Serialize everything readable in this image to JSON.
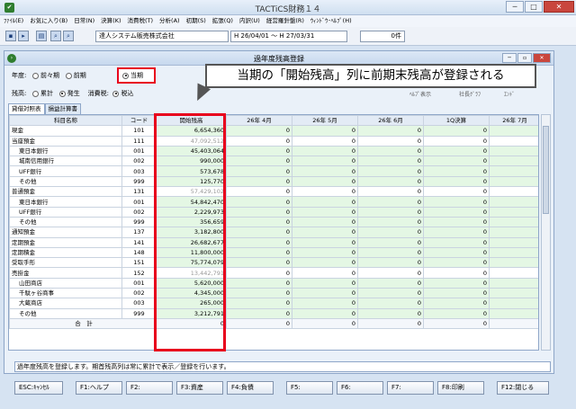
{
  "window_title": "TACTiCS財務１４",
  "menu": [
    "ﾌｧｲﾙ(E)",
    "お気に入り(B)",
    "日常(N)",
    "決算(K)",
    "消費税(T)",
    "分析(A)",
    "初期(S)",
    "拡張(Q)",
    "内訳(U)",
    "経営羅針盤(R)",
    "ｳｨﾝﾄﾞｳ･ﾍﾙﾌﾟ(H)"
  ],
  "toolbar": {
    "company": "達人システム販売株式会社",
    "period": "H 26/04/01 ～ H 27/03/31",
    "count": "0件"
  },
  "dialog_title": "過年度残高登録",
  "options": {
    "year_label": "年度:",
    "year_options": [
      "前々期",
      "前期",
      "当期"
    ],
    "year_selected": "当期",
    "balance_label": "残高:",
    "balance_options": [
      "累計",
      "発生"
    ],
    "balance_selected": "発生",
    "tax_label": "消費税:",
    "tax_value": "税込"
  },
  "callout": "当期の「開始残高」列に前期末残高が登録される",
  "right_links": [
    "ﾍﾙﾌﾟ表示",
    "社長ｸﾞﾗﾌ",
    "ｴﾝﾄﾞ"
  ],
  "tabs": [
    "貸借対照表",
    "損益計算書"
  ],
  "table": {
    "headers": [
      "科目名称",
      "コード",
      "開始残高",
      "26年 4月",
      "26年 5月",
      "26年 6月",
      "1Q決算",
      "26年 7月"
    ],
    "rows": [
      {
        "name": "現金",
        "code": "101",
        "start": "6,654,360",
        "vals": [
          "0",
          "0",
          "0",
          "0"
        ],
        "indent": 0,
        "green": true,
        "gray": false
      },
      {
        "name": "当座預金",
        "code": "111",
        "start": "47,092,512",
        "vals": [
          "0",
          "0",
          "0",
          "0"
        ],
        "indent": 0,
        "green": false,
        "gray": true
      },
      {
        "name": "東日本銀行",
        "code": "001",
        "start": "45,403,064",
        "vals": [
          "0",
          "0",
          "0",
          "0"
        ],
        "indent": 1,
        "green": true,
        "gray": false
      },
      {
        "name": "城南信用銀行",
        "code": "002",
        "start": "990,000",
        "vals": [
          "0",
          "0",
          "0",
          "0"
        ],
        "indent": 1,
        "green": true,
        "gray": false
      },
      {
        "name": "UFF銀行",
        "code": "003",
        "start": "573,678",
        "vals": [
          "0",
          "0",
          "0",
          "0"
        ],
        "indent": 1,
        "green": true,
        "gray": false
      },
      {
        "name": "その他",
        "code": "999",
        "start": "125,770",
        "vals": [
          "0",
          "0",
          "0",
          "0"
        ],
        "indent": 1,
        "green": true,
        "gray": false
      },
      {
        "name": "普通預金",
        "code": "131",
        "start": "57,429,102",
        "vals": [
          "0",
          "0",
          "0",
          "0"
        ],
        "indent": 0,
        "green": false,
        "gray": true
      },
      {
        "name": "東日本銀行",
        "code": "001",
        "start": "54,842,470",
        "vals": [
          "0",
          "0",
          "0",
          "0"
        ],
        "indent": 1,
        "green": true,
        "gray": false
      },
      {
        "name": "UFF銀行",
        "code": "002",
        "start": "2,229,973",
        "vals": [
          "0",
          "0",
          "0",
          "0"
        ],
        "indent": 1,
        "green": true,
        "gray": false
      },
      {
        "name": "その他",
        "code": "999",
        "start": "356,659",
        "vals": [
          "0",
          "0",
          "0",
          "0"
        ],
        "indent": 1,
        "green": true,
        "gray": false
      },
      {
        "name": "通知預金",
        "code": "137",
        "start": "3,182,800",
        "vals": [
          "0",
          "0",
          "0",
          "0"
        ],
        "indent": 0,
        "green": true,
        "gray": false
      },
      {
        "name": "定期預金",
        "code": "141",
        "start": "26,682,677",
        "vals": [
          "0",
          "0",
          "0",
          "0"
        ],
        "indent": 0,
        "green": true,
        "gray": false
      },
      {
        "name": "定期積金",
        "code": "148",
        "start": "11,800,000",
        "vals": [
          "0",
          "0",
          "0",
          "0"
        ],
        "indent": 0,
        "green": true,
        "gray": false
      },
      {
        "name": "受取手形",
        "code": "151",
        "start": "75,774,079",
        "vals": [
          "0",
          "0",
          "0",
          "0"
        ],
        "indent": 0,
        "green": true,
        "gray": false
      },
      {
        "name": "売掛金",
        "code": "152",
        "start": "13,442,791",
        "vals": [
          "0",
          "0",
          "0",
          "0"
        ],
        "indent": 0,
        "green": false,
        "gray": true
      },
      {
        "name": "山田商店",
        "code": "001",
        "start": "5,620,000",
        "vals": [
          "0",
          "0",
          "0",
          "0"
        ],
        "indent": 1,
        "green": true,
        "gray": false
      },
      {
        "name": "千駄ヶ谷商事",
        "code": "002",
        "start": "4,345,000",
        "vals": [
          "0",
          "0",
          "0",
          "0"
        ],
        "indent": 1,
        "green": true,
        "gray": false
      },
      {
        "name": "大蔵商店",
        "code": "003",
        "start": "265,000",
        "vals": [
          "0",
          "0",
          "0",
          "0"
        ],
        "indent": 1,
        "green": true,
        "gray": false
      },
      {
        "name": "その他",
        "code": "999",
        "start": "3,212,791",
        "vals": [
          "0",
          "0",
          "0",
          "0"
        ],
        "indent": 1,
        "green": true,
        "gray": false
      }
    ],
    "total": {
      "label": "合　計",
      "start": "0",
      "vals": [
        "0",
        "0",
        "0",
        "0"
      ]
    }
  },
  "status_text": "過年度残高を登録します。期首残高列は常に累計で表示／登録を行います。",
  "fkeys": [
    "ESC:ｷｬﾝｾﾙ",
    "F1:ヘルプ",
    "F2:",
    "F3:資産",
    "F4:負債",
    "F5:",
    "F6:",
    "F7:",
    "F8:印刷",
    "F12:閉じる"
  ]
}
